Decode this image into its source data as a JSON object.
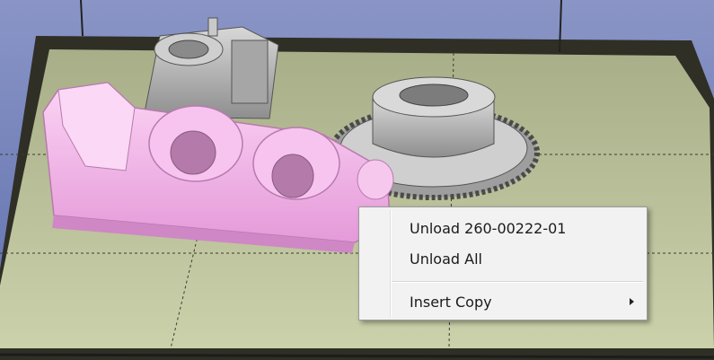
{
  "context_menu": {
    "items": [
      {
        "label": "Unload 260-00222-01"
      },
      {
        "label": "Unload All"
      },
      {
        "label": "Insert Copy",
        "has_submenu": true
      }
    ]
  },
  "colors": {
    "background": "#6f7fb8",
    "build_plate": "#bcc49a",
    "plate_rim": "#3a3a2c",
    "selected_part": "#f3b6ea",
    "unselected_part": "#bdbdbd",
    "menu_background": "#f2f2f2"
  },
  "icons": [
    "submenu-arrow-icon"
  ]
}
